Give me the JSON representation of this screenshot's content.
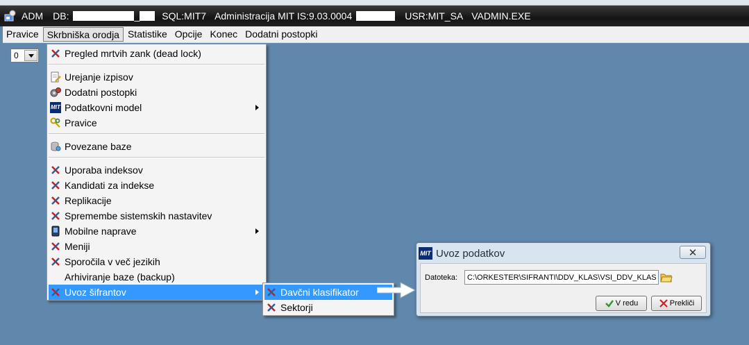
{
  "titlebar": {
    "app": "ADM",
    "db_label": "DB:",
    "db_suffix": "_",
    "sql": "SQL:MIT7",
    "admin": "Administracija MIT IS:9.03.0004",
    "user": "USR:MIT_SA",
    "exe": "VADMIN.EXE"
  },
  "menubar": [
    "Pravice",
    "Skrbniška orodja",
    "Statistike",
    "Opcije",
    "Konec",
    "Dodatni postopki"
  ],
  "combo": {
    "value": "0"
  },
  "main_menu": {
    "items": [
      {
        "label": "Pregled mrtvih zank (dead lock)",
        "icon": "tools-icon"
      },
      {
        "label": "Urejanje izpisov",
        "icon": "document-edit-icon"
      },
      {
        "label": "Dodatni postopki",
        "icon": "gears-icon"
      },
      {
        "label": "Podatkovni model",
        "icon": "mit-logo-icon"
      },
      {
        "label": "Pravice",
        "icon": "keys-icon"
      },
      {
        "label": "Povezane baze",
        "icon": "database-icon"
      },
      {
        "label": "Uporaba indeksov",
        "icon": "tools-icon"
      },
      {
        "label": "Kandidati za indekse",
        "icon": "tools-icon"
      },
      {
        "label": "Replikacije",
        "icon": "tools-icon"
      },
      {
        "label": "Spremembe sistemskih nastavitev",
        "icon": "tools-icon"
      },
      {
        "label": "Mobilne naprave",
        "icon": "mobile-device-icon"
      },
      {
        "label": "Meniji",
        "icon": "tools-icon"
      },
      {
        "label": "Sporočila v več jezikih",
        "icon": "tools-icon"
      },
      {
        "label": "Arhiviranje baze (backup)",
        "icon": ""
      },
      {
        "label": "Uvoz šifrantov",
        "icon": "tools-icon"
      }
    ]
  },
  "sub_menu": {
    "items": [
      {
        "label": "Davčni klasifikator",
        "icon": "tools-icon"
      },
      {
        "label": "Sektorji",
        "icon": "tools-icon"
      }
    ]
  },
  "dialog": {
    "title": "Uvoz podatkov",
    "logo": "MIT",
    "close": "✕",
    "file_label": "Datoteka:",
    "file_value": "C:\\ORKESTER\\SIFRANTI\\DDV_KLAS\\VSI_DDV_KLAS",
    "ok_label": "V redu",
    "cancel_label": "Prekliči"
  },
  "colors": {
    "desktop": "#6088ad",
    "highlight": "#3399ff",
    "titlebar": "#1a1a1a",
    "dialog_frame": "#d8e4f0"
  }
}
